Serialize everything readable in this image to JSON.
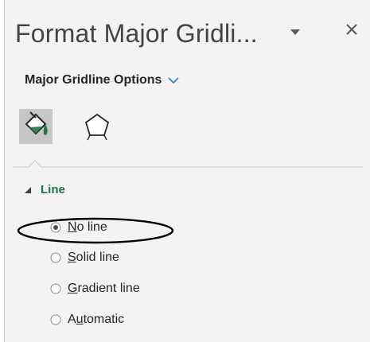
{
  "pane": {
    "title": "Format Major Gridli...",
    "options_label": "Major Gridline Options",
    "icons": {
      "title_dropdown": "chevron-down-icon",
      "close": "close-icon",
      "options_chevron": "chevron-down-icon",
      "fill_line_tab": "paint-bucket-icon",
      "effects_tab": "pentagon-icon",
      "section_toggle": "triangle-expanded-icon"
    }
  },
  "section": {
    "label": "Line"
  },
  "line_options": [
    {
      "accel": "N",
      "rest": "o line",
      "selected": true
    },
    {
      "accel": "S",
      "rest": "olid line",
      "selected": false
    },
    {
      "accel": "G",
      "rest": "radient line",
      "selected": false
    },
    {
      "pre": "A",
      "accel": "u",
      "rest": "tomatic",
      "selected": false
    }
  ],
  "colors": {
    "section_label": "#217346",
    "title_text": "#444444",
    "selected_tab_bg": "#c6c6c6",
    "pane_bg": "#f3f3f3"
  }
}
